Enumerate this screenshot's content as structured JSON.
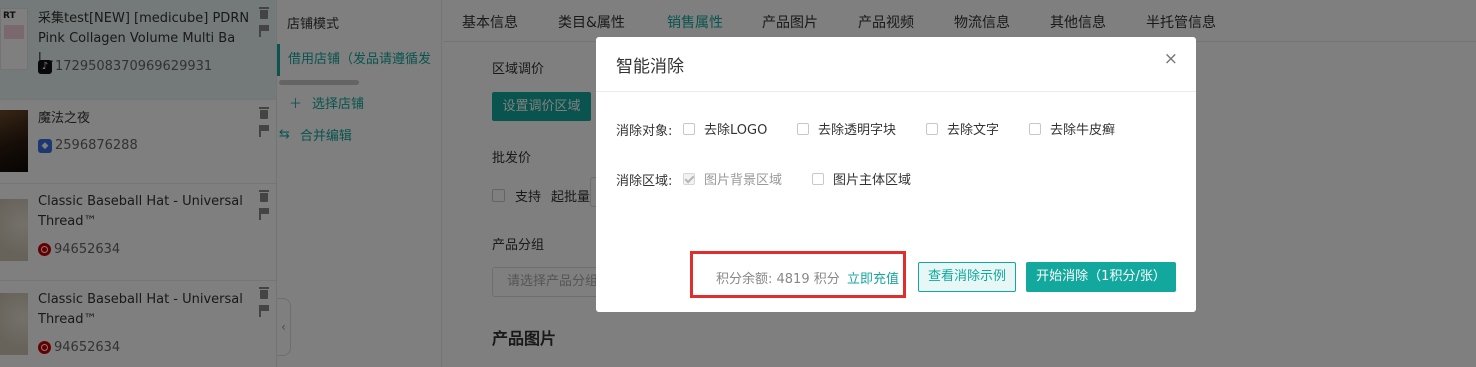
{
  "colors": {
    "accent": "#13a89e",
    "highlight_border": "#e02d2d"
  },
  "products": [
    {
      "title": "采集test[NEW] [medicube] PDRN Pink Collagen Volume Multi Bal...",
      "id": "1729508370969629931",
      "platform_icon": "tiktok-icon",
      "thumb_text": "RT"
    },
    {
      "title": "魔法之夜",
      "id": "2596876288",
      "platform_icon": "shop-icon"
    },
    {
      "title": "Classic Baseball Hat - Universal Thread™",
      "id": "94652634",
      "platform_icon": "target-icon"
    },
    {
      "title": "Classic Baseball Hat - Universal Thread™",
      "id": "94652634",
      "platform_icon": "target-icon"
    }
  ],
  "store_panel": {
    "mode_title": "店铺模式",
    "active_store": "借用店铺（发品请遵循发",
    "select_store": "选择店铺",
    "merge_edit": "合并编辑"
  },
  "tabs": [
    "基本信息",
    "类目&属性",
    "销售属性",
    "产品图片",
    "产品视频",
    "物流信息",
    "其他信息",
    "半托管信息"
  ],
  "form": {
    "region_price_label": "区域调价",
    "region_price_button": "设置调价区域",
    "wholesale_label": "批发价",
    "support_label": "支持",
    "min_batch_label": "起批量",
    "group_label": "产品分组",
    "group_placeholder": "请选择产品分组",
    "images_title": "产品图片"
  },
  "modal": {
    "title": "智能消除",
    "close_glyph": "×",
    "target_label": "消除对象:",
    "targets": [
      {
        "label": "去除LOGO",
        "checked": false
      },
      {
        "label": "去除透明字块",
        "checked": false
      },
      {
        "label": "去除文字",
        "checked": false
      },
      {
        "label": "去除牛皮癣",
        "checked": false
      }
    ],
    "region_label": "消除区域:",
    "regions": [
      {
        "label": "图片背景区域",
        "checked": true,
        "disabled": true
      },
      {
        "label": "图片主体区域",
        "checked": false
      }
    ],
    "points_text": "积分余额: 4819 积分",
    "recharge": "立即充值",
    "example_button": "查看消除示例",
    "start_button": "开始消除（1积分/张）"
  }
}
